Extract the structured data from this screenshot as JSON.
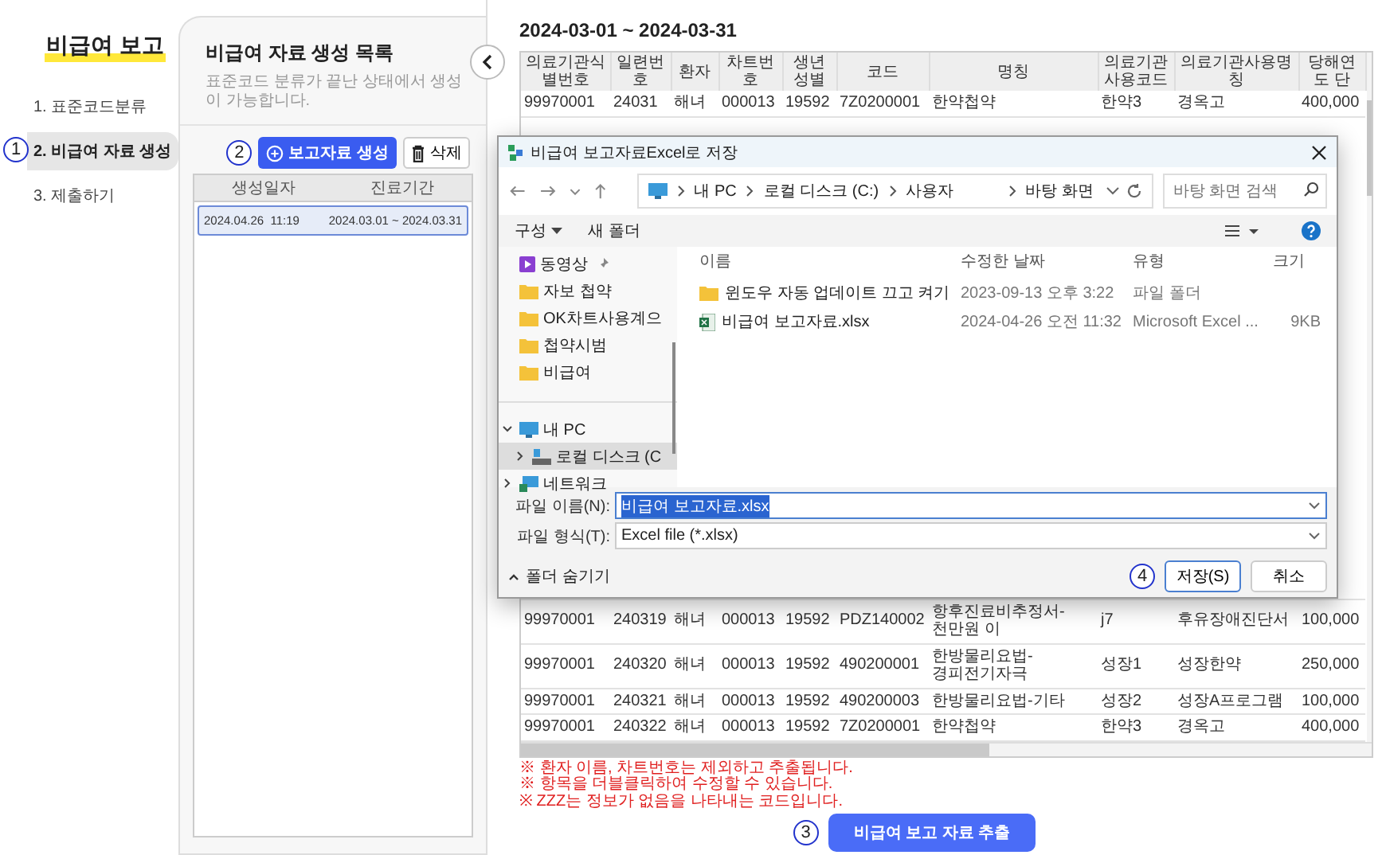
{
  "sidebar": {
    "title": "비급여 보고",
    "step_marker": "1",
    "items": [
      {
        "label": "1. 표준코드분류",
        "selected": false
      },
      {
        "label": "2. 비급여 자료 생성",
        "selected": true
      },
      {
        "label": "3. 제출하기",
        "selected": false
      }
    ]
  },
  "list_panel": {
    "title": "비급여 자료 생성 목록",
    "subtitle": "표준코드 분류가 끝난 상태에서 생성이 가능합니다.",
    "step_marker": "2",
    "create_button": "보고자료 생성",
    "delete_button": "삭제",
    "columns": [
      "생성일자",
      "진료기간"
    ],
    "rows": [
      {
        "created": "2024.04.26  11:19",
        "period": "2024.03.01 ~ 2024.03.31",
        "selected": true
      }
    ]
  },
  "main": {
    "period_title": "2024-03-01 ~ 2024-03-31",
    "table": {
      "columns": [
        "의료기관식별번호",
        "일련번호",
        "환자",
        "차트번호",
        "생년성별",
        "코드",
        "명칭",
        "의료기관사용코드",
        "의료기관사용명칭",
        "당해연도 단"
      ],
      "top_rows": [
        [
          "99970001",
          "24031",
          "해녀",
          "000013",
          "19592",
          "7Z0200001",
          "한약첩약",
          "한약3",
          "경옥고",
          "400,000"
        ]
      ],
      "bottom_rows": [
        [
          "99970001",
          "240319",
          "해녀",
          "000013",
          "19592",
          "PDZ140002",
          "항후진료비추정서-천만원 이",
          "j7",
          "후유장애진단서",
          "100,000"
        ],
        [
          "99970001",
          "240320",
          "해녀",
          "000013",
          "19592",
          "490200001",
          "한방물리요법-경피전기자극",
          "성장1",
          "성장한약",
          "250,000"
        ],
        [
          "99970001",
          "240321",
          "해녀",
          "000013",
          "19592",
          "490200003",
          "한방물리요법-기타",
          "성장2",
          "성장A프로그램",
          "100,000"
        ],
        [
          "99970001",
          "240322",
          "해녀",
          "000013",
          "19592",
          "7Z0200001",
          "한약첩약",
          "한약3",
          "경옥고",
          "400,000"
        ]
      ]
    },
    "notes": [
      "※ 환자 이름, 차트번호는 제외하고 추출됩니다.",
      "※ 항목을 더블클릭하여 수정할 수 있습니다.",
      "※ ZZZ는 정보가 없음을 나타내는 코드입니다."
    ],
    "step_marker": "3",
    "export_button": "비급여 보고 자료 추출"
  },
  "dialog": {
    "title": "비급여 보고자료Excel로 저장",
    "path": [
      "내 PC",
      "로컬 디스크 (C:)",
      "사용자",
      "바탕 화면"
    ],
    "search_placeholder": "바탕 화면 검색",
    "organize": "구성",
    "new_folder": "새 폴더",
    "nav": [
      {
        "label": "동영상",
        "kind": "video",
        "pinned": true,
        "selected": false
      },
      {
        "label": "자보 첩약",
        "kind": "folder",
        "pinned": false,
        "selected": false
      },
      {
        "label": "OK차트사용계으",
        "kind": "folder",
        "pinned": false,
        "selected": false
      },
      {
        "label": "첩약시범",
        "kind": "folder",
        "pinned": false,
        "selected": false
      },
      {
        "label": "비급여",
        "kind": "folder",
        "pinned": false,
        "selected": false
      },
      {
        "label": "내 PC",
        "kind": "pc",
        "expanded": true,
        "selected": false,
        "children": [
          {
            "label": "로컬 디스크 (C",
            "kind": "disk",
            "expanded": false,
            "selected": true
          }
        ]
      },
      {
        "label": "네트워크",
        "kind": "network",
        "expanded": false,
        "selected": false
      }
    ],
    "columns": [
      "이름",
      "수정한 날짜",
      "유형",
      "크기"
    ],
    "files": [
      {
        "name": "윈도우 자동 업데이트 끄고 켜기",
        "kind": "folder",
        "modified": "2023-09-13 오후 3:22",
        "type": "파일 폴더"
      },
      {
        "name": "비급여 보고자료.xlsx",
        "kind": "excel",
        "modified": "2024-04-26 오전 11:32",
        "type": "Microsoft Excel ...",
        "size": "9KB"
      }
    ],
    "filename_label": "파일 이름(N):",
    "filename": "비급여 보고자료.xlsx",
    "filetype_label": "파일 형식(T):",
    "filetype": "Excel file (*.xlsx)",
    "hide_folders": "폴더 숨기기",
    "save": "저장(S)",
    "cancel": "취소",
    "step_marker": "4"
  }
}
